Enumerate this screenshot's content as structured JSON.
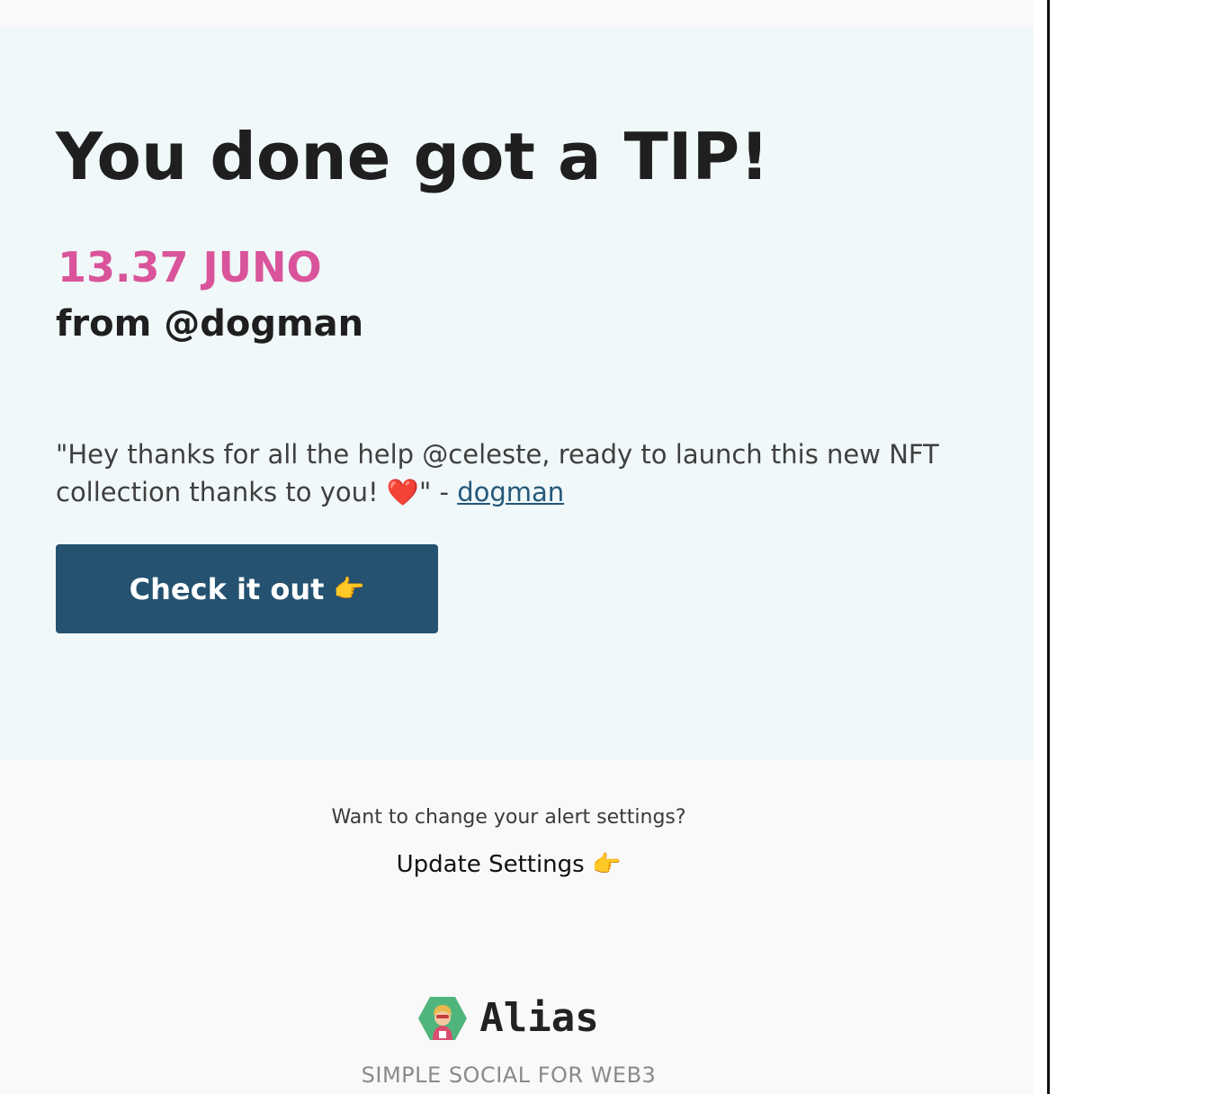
{
  "email": {
    "headline": "You done got a TIP!",
    "amount": "13.37 JUNO",
    "from": "from @dogman",
    "message": {
      "quote": "\"Hey thanks for all the help @celeste, ready to launch this new NFT collection thanks to you! ❤️\" - ",
      "author_link": "dogman"
    },
    "cta": {
      "label": "Check it out",
      "emoji": "👉"
    }
  },
  "footer": {
    "alert_question": "Want to change your alert settings?",
    "update_label": "Update Settings",
    "update_emoji": "👉",
    "brand_name": "Alias",
    "tagline": "SIMPLE SOCIAL FOR WEB3",
    "logo_icon": "superhero-hexagon-icon"
  },
  "colors": {
    "accent_pink": "#d9549a",
    "button_blue": "#245270",
    "link_blue": "#24587a",
    "card_bg": "#f0f8f9",
    "logo_green": "#4fb57c"
  }
}
